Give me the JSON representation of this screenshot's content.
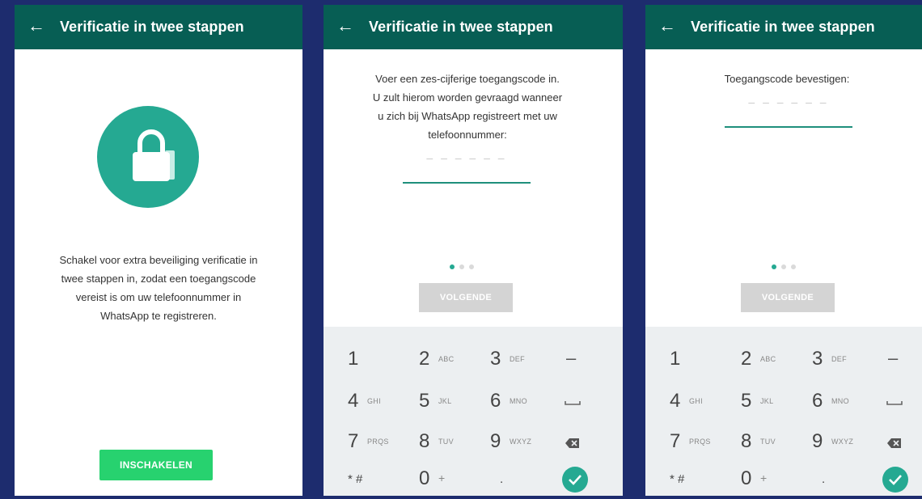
{
  "colors": {
    "appbar": "#075e54",
    "accent": "#25a992",
    "enable_button": "#27d26f",
    "disabled_button": "#d4d4d4",
    "keypad_bg": "#eceff1"
  },
  "screen1": {
    "title": "Verificatie in twee stappen",
    "icon": "lock-icon",
    "description": [
      "Schakel voor extra beveiliging verificatie in",
      "twee stappen in, zodat een toegangscode",
      "vereist is om uw telefoonnummer in",
      "WhatsApp te registreren."
    ],
    "button": "INSCHAKELEN"
  },
  "screen2": {
    "title": "Verificatie in twee stappen",
    "instruction": [
      "Voer een zes-cijferige toegangscode in.",
      "U zult hierom worden gevraagd wanneer",
      "u zich bij WhatsApp registreert met uw",
      "telefoonnummer:"
    ],
    "placeholder": "– – –   – – –",
    "page_indicator": {
      "current": 1,
      "total": 3
    },
    "button": "VOLGENDE"
  },
  "screen3": {
    "title": "Verificatie in twee stappen",
    "instruction": "Toegangscode bevestigen:",
    "placeholder": "– – –   – – –",
    "page_indicator": {
      "current": 1,
      "total": 3
    },
    "button": "VOLGENDE"
  },
  "keypad": {
    "row1": [
      {
        "n": "1",
        "l": ""
      },
      {
        "n": "2",
        "l": "ABC"
      },
      {
        "n": "3",
        "l": "DEF"
      },
      {
        "n": "–",
        "l": ""
      }
    ],
    "row2": [
      {
        "n": "4",
        "l": "GHI"
      },
      {
        "n": "5",
        "l": "JKL"
      },
      {
        "n": "6",
        "l": "MNO"
      },
      {
        "n": "space-icon",
        "l": ""
      }
    ],
    "row3": [
      {
        "n": "7",
        "l": "PRQS"
      },
      {
        "n": "8",
        "l": "TUV"
      },
      {
        "n": "9",
        "l": "WXYZ"
      },
      {
        "n": "backspace-icon",
        "l": ""
      }
    ],
    "row4": [
      {
        "n": "* #",
        "l": ""
      },
      {
        "n": "0",
        "l": "+"
      },
      {
        "n": ".",
        "l": ""
      },
      {
        "n": "check-icon",
        "l": ""
      }
    ]
  }
}
